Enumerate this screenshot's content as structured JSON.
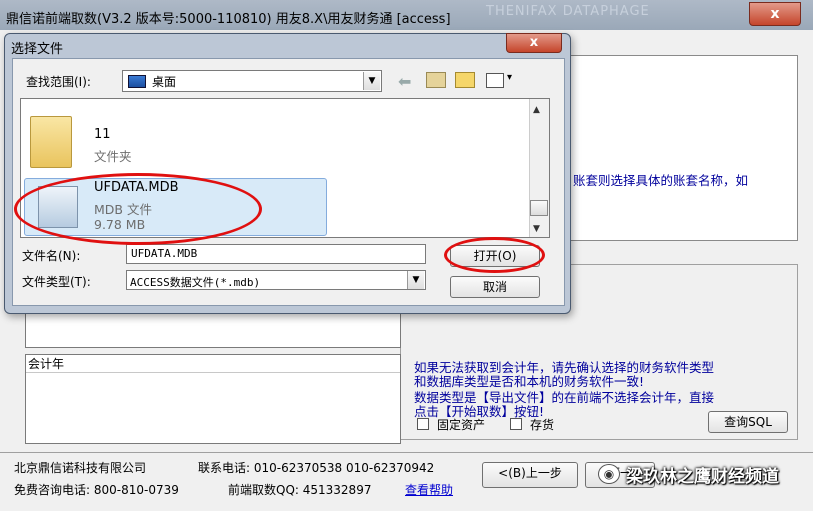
{
  "main_window": {
    "title": "鼎信诺前端取数(V3.2 版本号:5000-110810)  用友8.X\\用友财务通 [access]",
    "title_bg_text": "THENIFAX DATAPHAGE",
    "close_symbol": "x"
  },
  "right_panel": {
    "top_text": "账套则选择具体的账套名称，如"
  },
  "fiscal_year": {
    "label": "会计年"
  },
  "notes": [
    "如果无法获取到会计年，请先确认选择的财务软件类型",
    "和数据库类型是否和本机的财务软件一致!",
    "数据类型是【导出文件】的在前端不选择会计年，直接",
    "点击【开始取数】按钮!"
  ],
  "options": {
    "fixed_assets": "固定资产",
    "stock": "存货",
    "query_sql": "查询SQL"
  },
  "footer": {
    "company": "北京鼎信诺科技有限公司",
    "phone": "联系电话: 010-62370538 010-62370942",
    "consult": "免费咨询电话: 800-810-0739",
    "qq": "前端取数QQ: 451332897",
    "help_link": "查看帮助",
    "prev_step": "<(B)上一步",
    "next_step": "下一"
  },
  "watermark": {
    "text": "梁玖林之鹰财经频道"
  },
  "dialog": {
    "title": "选择文件",
    "close_symbol": "x",
    "lookin_label": "查找范围(I):",
    "lookin_value": "桌面",
    "views_caret": "▾",
    "items": [
      {
        "name": "11",
        "type": "文件夹"
      },
      {
        "name": "UFDATA.MDB",
        "type": "MDB 文件",
        "size": "9.78 MB"
      }
    ],
    "filename_label": "文件名(N):",
    "filename_value": "UFDATA.MDB",
    "filetype_label": "文件类型(T):",
    "filetype_value": "ACCESS数据文件(*.mdb)",
    "open_label": "打开(O)",
    "cancel_label": "取消"
  },
  "colors": {
    "highlight_ellipse": "#e01010",
    "note_text": "#00009c",
    "selection_fill": "#d8eaf8"
  }
}
